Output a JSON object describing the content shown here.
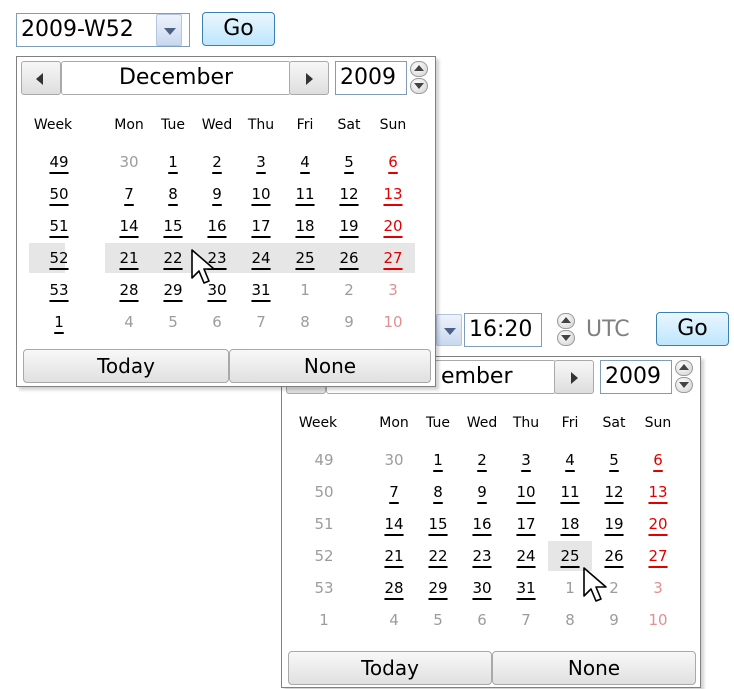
{
  "week_form": {
    "value": "2009-W52",
    "go_label": "Go"
  },
  "datetime_form": {
    "time_value": "16:20",
    "timezone": "UTC",
    "go_label": "Go"
  },
  "calendar_week": {
    "month": "December",
    "year": "2009",
    "headers": [
      "Week",
      "Mon",
      "Tue",
      "Wed",
      "Thu",
      "Fri",
      "Sat",
      "Sun"
    ],
    "weeks": [
      "49",
      "50",
      "51",
      "52",
      "53",
      "1"
    ],
    "days": [
      [
        "30",
        "1",
        "2",
        "3",
        "4",
        "5",
        "6"
      ],
      [
        "7",
        "8",
        "9",
        "10",
        "11",
        "12",
        "13"
      ],
      [
        "14",
        "15",
        "16",
        "17",
        "18",
        "19",
        "20"
      ],
      [
        "21",
        "22",
        "23",
        "24",
        "25",
        "26",
        "27"
      ],
      [
        "28",
        "29",
        "30",
        "31",
        "1",
        "2",
        "3"
      ],
      [
        "4",
        "5",
        "6",
        "7",
        "8",
        "9",
        "10"
      ]
    ],
    "today_label": "Today",
    "none_label": "None"
  },
  "calendar_datetime": {
    "month_visible": "ember",
    "year": "2009",
    "headers": [
      "Week",
      "Mon",
      "Tue",
      "Wed",
      "Thu",
      "Fri",
      "Sat",
      "Sun"
    ],
    "weeks": [
      "49",
      "50",
      "51",
      "52",
      "53",
      "1"
    ],
    "days": [
      [
        "30",
        "1",
        "2",
        "3",
        "4",
        "5",
        "6"
      ],
      [
        "7",
        "8",
        "9",
        "10",
        "11",
        "12",
        "13"
      ],
      [
        "14",
        "15",
        "16",
        "17",
        "18",
        "19",
        "20"
      ],
      [
        "21",
        "22",
        "23",
        "24",
        "25",
        "26",
        "27"
      ],
      [
        "28",
        "29",
        "30",
        "31",
        "1",
        "2",
        "3"
      ],
      [
        "4",
        "5",
        "6",
        "7",
        "8",
        "9",
        "10"
      ]
    ],
    "today_label": "Today",
    "none_label": "None"
  },
  "colors": {
    "sunday": "#e00000",
    "other_month": "#9c9c9c",
    "highlight": "#e6e6e6",
    "go_button": "#bee6fd"
  },
  "icons": [
    "dropdown-arrow-icon",
    "spin-up-icon",
    "spin-down-icon",
    "prev-month-icon",
    "next-month-icon",
    "mouse-pointer-icon"
  ]
}
